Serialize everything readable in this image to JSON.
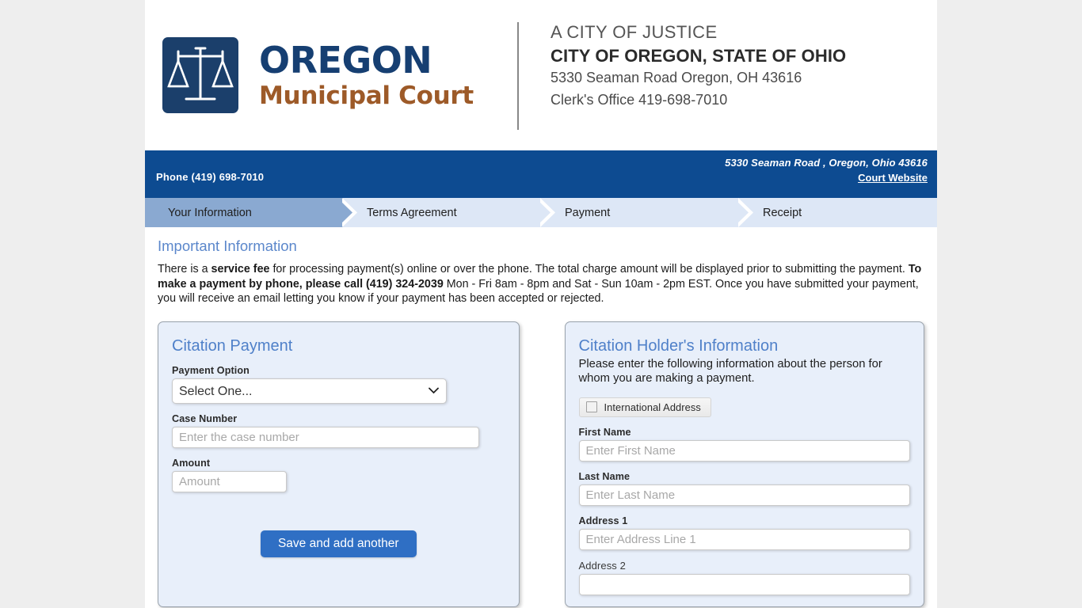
{
  "masthead": {
    "logo": {
      "icon": "scales-of-justice-icon",
      "line1": "OREGON",
      "line2": "Municipal Court"
    },
    "tagline": "A CITY OF JUSTICE",
    "city": "CITY OF OREGON, STATE OF OHIO",
    "address": "5330 Seaman Road Oregon, OH 43616",
    "clerk": "Clerk's Office 419-698-7010"
  },
  "blue_bar": {
    "phone": "Phone (419) 698-7010",
    "address": "5330 Seaman Road , Oregon, Ohio 43616",
    "court_website_link": "Court Website"
  },
  "steps": [
    {
      "label": "Your Information",
      "active": true
    },
    {
      "label": "Terms Agreement",
      "active": false
    },
    {
      "label": "Payment",
      "active": false
    },
    {
      "label": "Receipt",
      "active": false
    }
  ],
  "important_information": {
    "title": "Important Information",
    "text_part1": "There is a ",
    "bold1": "service fee",
    "text_part2": " for processing payment(s) online or over the phone. The total charge amount will be displayed prior to submitting the payment. ",
    "bold2": "To make a payment by phone, please call (419) 324-2039",
    "text_part3": " Mon - Fri 8am - 8pm and Sat - Sun 10am - 2pm EST. Once you have submitted your payment, you will receive an email letting you know if your payment has been accepted or rejected."
  },
  "citation_payment": {
    "title": "Citation Payment",
    "payment_option_label": "Payment Option",
    "payment_option_selected": "Select One...",
    "payment_option_choices": [
      "Select One..."
    ],
    "case_number_label": "Case Number",
    "case_number_placeholder": "Enter the case number",
    "case_number_value": "",
    "amount_label": "Amount",
    "amount_placeholder": "Amount",
    "amount_value": "",
    "save_button": "Save and add another"
  },
  "citation_holder": {
    "title": "Citation Holder's Information",
    "subtitle": "Please enter the following information about the person for whom you are making a payment.",
    "international_address_label": "International Address",
    "international_address_checked": false,
    "first_name_label": "First Name",
    "first_name_placeholder": "Enter First Name",
    "first_name_value": "",
    "last_name_label": "Last Name",
    "last_name_placeholder": "Enter Last Name",
    "last_name_value": "",
    "address1_label": "Address 1",
    "address1_placeholder": "Enter Address Line 1",
    "address1_value": "",
    "address2_label": "Address 2",
    "address2_placeholder": "",
    "address2_value": ""
  },
  "colors": {
    "brand_blue": "#0d4b91",
    "logo_navy": "#163f72",
    "logo_brown": "#9d5a28",
    "panel_bg": "#e8effa",
    "accent_link": "#5b87cb",
    "button_blue": "#2f6fc4",
    "step_active": "#8aa9d1",
    "step_inactive": "#dde7f6",
    "page_bg": "#eeeeee"
  }
}
